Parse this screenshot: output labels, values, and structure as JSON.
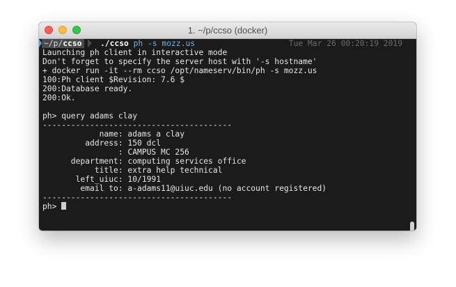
{
  "window": {
    "title": "1. ~/p/ccso (docker)"
  },
  "prompt": {
    "path_prefix": "~/p/",
    "path_dir": "ccso",
    "command_exe": "./ccso",
    "command_args": "ph -s mozz.us",
    "timestamp": "Tue Mar 26 00:20:19 2019"
  },
  "output_lines": [
    "Launching ph client in interactive mode",
    "Don't forget to specify the server host with '-s hostname'",
    "+ docker run -it --rm ccso /opt/nameserv/bin/ph -s mozz.us",
    "100:Ph client $Revision: 7.6 $",
    "200:Database ready.",
    "200:Ok.",
    "",
    "ph> query adams clay",
    "----------------------------------------",
    "            name: adams a clay",
    "         address: 150 dcl",
    "                : CAMPUS MC 256",
    "      department: computing services office",
    "           title: extra help technical",
    "       left_uiuc: 10/1991",
    "        email to: a-adams11@uiuc.edu (no account registered)",
    "----------------------------------------"
  ],
  "input_prompt": "ph> ",
  "colors": {
    "terminal_bg": "#1b1b1c",
    "text": "#e6e6e6",
    "args": "#6fb3e6",
    "timestamp": "#6a6a6a"
  }
}
